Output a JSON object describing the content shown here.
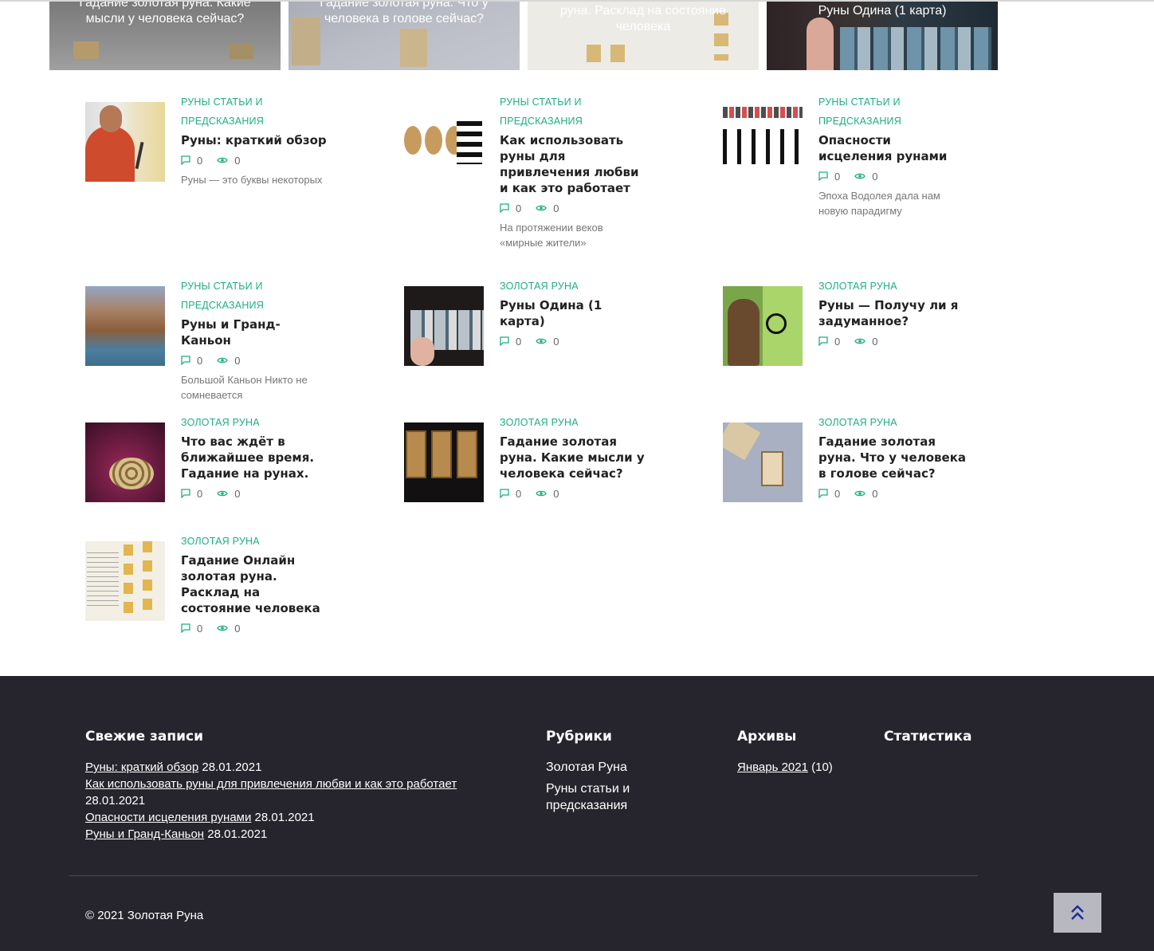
{
  "slider": [
    {
      "caption": "Гадание золотая руна. Какие мысли у человека сейчас?"
    },
    {
      "caption": "Гадание золотая руна. Что у человека в голове сейчас?"
    },
    {
      "caption": "руна. Расклад на состояние человека"
    },
    {
      "caption": "Руны Одина (1 карта)"
    }
  ],
  "posts": [
    {
      "category": "Руны статьи и предсказания",
      "title": "Руны: краткий обзор",
      "comments": "0",
      "views": "0",
      "excerpt": "Руны — это буквы некоторых"
    },
    {
      "category": "Руны статьи и предсказания",
      "title": "Как использовать руны для привлечения любви и как это работает",
      "comments": "0",
      "views": "0",
      "excerpt": "На протяжении веков «мирные жители»"
    },
    {
      "category": "Руны статьи и предсказания",
      "title": "Опасности исцеления рунами",
      "comments": "0",
      "views": "0",
      "excerpt": "Эпоха Водолея дала нам новую парадигму"
    },
    {
      "category": "Руны статьи и предсказания",
      "title": "Руны и Гранд-Каньон",
      "comments": "0",
      "views": "0",
      "excerpt": "Большой Каньон Никто не сомневается"
    },
    {
      "category": "Золотая Руна",
      "title": "Руны Одина (1 карта)",
      "comments": "0",
      "views": "0",
      "excerpt": ""
    },
    {
      "category": "Золотая Руна",
      "title": "Руны — Получу ли я задуманное?",
      "comments": "0",
      "views": "0",
      "excerpt": ""
    },
    {
      "category": "Золотая Руна",
      "title": "Что вас ждёт в ближайшее время. Гадание на рунах.",
      "comments": "0",
      "views": "0",
      "excerpt": ""
    },
    {
      "category": "Золотая Руна",
      "title": "Гадание золотая руна. Какие мысли у человека сейчас?",
      "comments": "0",
      "views": "0",
      "excerpt": ""
    },
    {
      "category": "Золотая Руна",
      "title": "Гадание золотая руна. Что у человека в голове сейчас?",
      "comments": "0",
      "views": "0",
      "excerpt": ""
    },
    {
      "category": "Золотая Руна",
      "title": "Гадание Онлайн золотая руна. Расклад на состояние человека",
      "comments": "0",
      "views": "0",
      "excerpt": ""
    }
  ],
  "footer": {
    "recent": {
      "heading": "Свежие записи",
      "items": [
        {
          "link": "Руны: краткий обзор",
          "date": "28.01.2021"
        },
        {
          "link": "Как использовать руны для привлечения любви и как это работает",
          "date": "28.01.2021"
        },
        {
          "link": "Опасности исцеления рунами",
          "date": "28.01.2021"
        },
        {
          "link": "Руны и Гранд-Каньон",
          "date": "28.01.2021"
        }
      ]
    },
    "categories": {
      "heading": "Рубрики",
      "items": [
        "Золотая Руна",
        "Руны статьи и предсказания"
      ]
    },
    "archives": {
      "heading": "Архивы",
      "link": "Январь 2021",
      "count": "(10)"
    },
    "stats": {
      "heading": "Статистика"
    },
    "copyright": "© 2021 Золотая Руна"
  },
  "colors": {
    "accent": "#1fad85",
    "footer_bg": "#26252d",
    "to_top_bg": "#b8b8c0",
    "to_top_icon": "#1d2b9a"
  },
  "icons": {
    "comment": "comment-icon",
    "views": "eye-icon",
    "to_top": "double-chevron-up-icon"
  }
}
